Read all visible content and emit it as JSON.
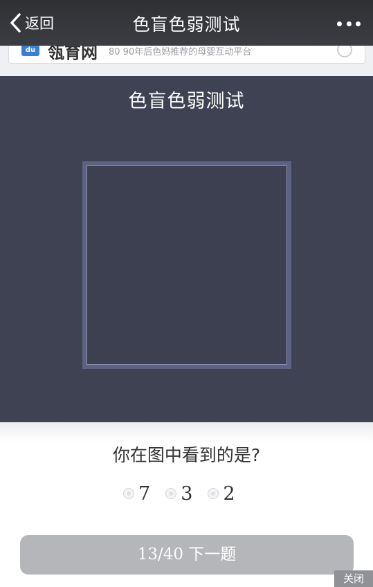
{
  "navbar": {
    "back_label": "返回",
    "title": "色盲色弱测试",
    "more_icon": "more-dots-icon"
  },
  "banner": {
    "logo_text": "du",
    "brand": "瓴育网",
    "slogan": "80 90年后色妈推荐的母婴互动平台"
  },
  "test": {
    "heading": "色盲色弱测试"
  },
  "question": {
    "text": "你在图中看到的是?",
    "options": [
      "7",
      "3",
      "2"
    ],
    "next_button": "13/40 下一题"
  },
  "close_label": "关闭",
  "colors": {
    "navbar_bg": "#35363a",
    "panel_bg": "#3f4252",
    "frame_border": "#5c6280",
    "button_bg": "#b5b6b9"
  }
}
